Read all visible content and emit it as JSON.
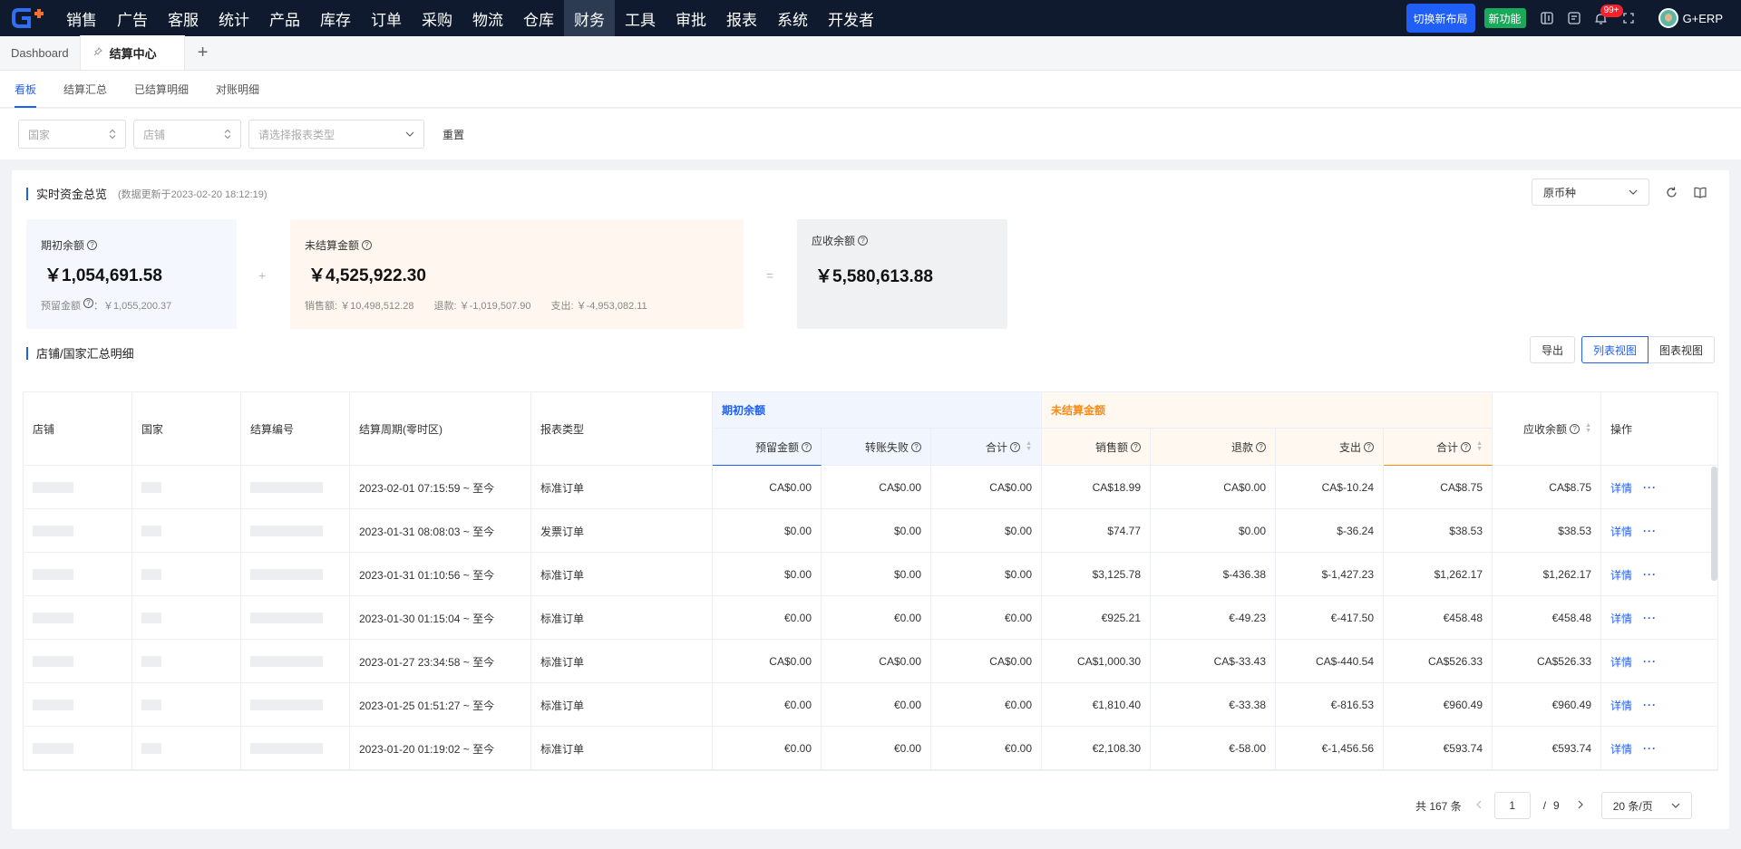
{
  "nav": {
    "items": [
      "销售",
      "广告",
      "客服",
      "统计",
      "产品",
      "库存",
      "订单",
      "采购",
      "物流",
      "仓库",
      "财务",
      "工具",
      "审批",
      "报表",
      "系统",
      "开发者"
    ],
    "active_index": 10,
    "switch_layout": "切换新布局",
    "new_feature": "新功能",
    "notification_badge": "99+",
    "user": "G+ERP"
  },
  "page_tabs": {
    "dashboard": "Dashboard",
    "active": "结算中心",
    "add": "+"
  },
  "sub_tabs": [
    "看板",
    "结算汇总",
    "已结算明细",
    "对账明细"
  ],
  "filters": {
    "country_placeholder": "国家",
    "store_placeholder": "店铺",
    "report_type_placeholder": "请选择报表类型",
    "reset": "重置"
  },
  "overview": {
    "title": "实时资金总览",
    "updated": "(数据更新于2023-02-20 18:12:19)",
    "currency": "原币种",
    "opening": {
      "label": "期初余额",
      "amount": "￥1,054,691.58",
      "reserved_label": "预留金额",
      "reserved_value": "：￥1,055,200.37"
    },
    "plus": "+",
    "unsettled": {
      "label": "未结算金额",
      "amount": "￥4,525,922.30",
      "sales": "销售额: ￥10,498,512.28",
      "refund": "退款: ￥-1,019,507.90",
      "expense": "支出: ￥-4,953,082.11"
    },
    "equals": "=",
    "receivable": {
      "label": "应收余额",
      "amount": "￥5,580,613.88"
    }
  },
  "detail": {
    "title": "店铺/国家汇总明细",
    "export": "导出",
    "list_view": "列表视图",
    "chart_view": "图表视图"
  },
  "table": {
    "headers": {
      "store": "店铺",
      "country": "国家",
      "settlement_no": "结算编号",
      "period": "结算周期(零时区)",
      "report_type": "报表类型",
      "opening_group": "期初余额",
      "reserved": "预留金额",
      "transfer_failed": "转账失败",
      "opening_total": "合计",
      "unsettled_group": "未结算金额",
      "sales": "销售额",
      "refund": "退款",
      "expense": "支出",
      "unsettled_total": "合计",
      "receivable": "应收余额",
      "actions": "操作"
    },
    "detail_link": "详情",
    "more": "···",
    "rows": [
      {
        "period": "2023-02-01 07:15:59 ~ 至今",
        "type": "标准订单",
        "reserved": "CA$0.00",
        "transfer_failed": "CA$0.00",
        "opening_total": "CA$0.00",
        "sales": "CA$18.99",
        "refund": "CA$0.00",
        "expense": "CA$-10.24",
        "unsettled_total": "CA$8.75",
        "receivable": "CA$8.75"
      },
      {
        "period": "2023-01-31 08:08:03 ~ 至今",
        "type": "发票订单",
        "reserved": "$0.00",
        "transfer_failed": "$0.00",
        "opening_total": "$0.00",
        "sales": "$74.77",
        "refund": "$0.00",
        "expense": "$-36.24",
        "unsettled_total": "$38.53",
        "receivable": "$38.53"
      },
      {
        "period": "2023-01-31 01:10:56 ~ 至今",
        "type": "标准订单",
        "reserved": "$0.00",
        "transfer_failed": "$0.00",
        "opening_total": "$0.00",
        "sales": "$3,125.78",
        "refund": "$-436.38",
        "expense": "$-1,427.23",
        "unsettled_total": "$1,262.17",
        "receivable": "$1,262.17"
      },
      {
        "period": "2023-01-30 01:15:04 ~ 至今",
        "type": "标准订单",
        "reserved": "€0.00",
        "transfer_failed": "€0.00",
        "opening_total": "€0.00",
        "sales": "€925.21",
        "refund": "€-49.23",
        "expense": "€-417.50",
        "unsettled_total": "€458.48",
        "receivable": "€458.48"
      },
      {
        "period": "2023-01-27 23:34:58 ~ 至今",
        "type": "标准订单",
        "reserved": "CA$0.00",
        "transfer_failed": "CA$0.00",
        "opening_total": "CA$0.00",
        "sales": "CA$1,000.30",
        "refund": "CA$-33.43",
        "expense": "CA$-440.54",
        "unsettled_total": "CA$526.33",
        "receivable": "CA$526.33"
      },
      {
        "period": "2023-01-25 01:51:27 ~ 至今",
        "type": "标准订单",
        "reserved": "€0.00",
        "transfer_failed": "€0.00",
        "opening_total": "€0.00",
        "sales": "€1,810.40",
        "refund": "€-33.38",
        "expense": "€-816.53",
        "unsettled_total": "€960.49",
        "receivable": "€960.49"
      },
      {
        "period": "2023-01-20 01:19:02 ~ 至今",
        "type": "标准订单",
        "reserved": "€0.00",
        "transfer_failed": "€0.00",
        "opening_total": "€0.00",
        "sales": "€2,108.30",
        "refund": "€-58.00",
        "expense": "€-1,456.56",
        "unsettled_total": "€593.74",
        "receivable": "€593.74"
      }
    ]
  },
  "pagination": {
    "total": "共 167 条",
    "page": "1",
    "separator": "/",
    "pages": "9",
    "page_size": "20 条/页"
  },
  "colors": {
    "nav_bg": "#0f1a2e",
    "accent": "#1f5ff5",
    "orange": "#fa8c16",
    "new_green": "#19a95a"
  }
}
